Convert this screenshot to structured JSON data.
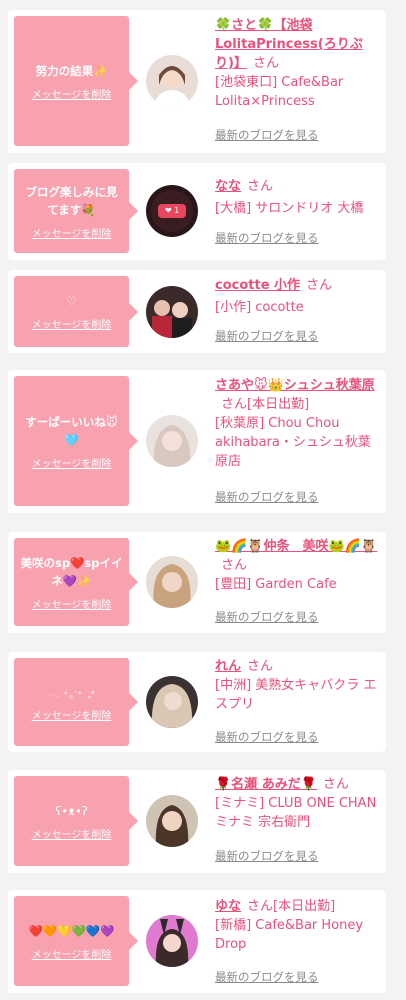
{
  "delete_label": "メッセージを削除",
  "blog_label": "最新のブログを見る",
  "san_label": "さん",
  "colors": {
    "accent": "#e8527b",
    "bubble": "#f8a2b0",
    "background": "#f3f3f3",
    "card": "#ffffff",
    "link_gray": "#8a8a8a"
  },
  "cards": [
    {
      "message": "努力の結果✨",
      "name": "🍀さと🍀【池袋LolitaPrincess(ろりぷり)】",
      "suffix": "",
      "shop": "[池袋東口] Cafe&Bar Lolita×Princess",
      "avatar": "avatar-photo-1"
    },
    {
      "message": "ブログ楽しみに見てます💐",
      "name": "なな",
      "suffix": "",
      "shop": "[大橋] サロンドリオ 大橋",
      "avatar": "avatar-photo-2",
      "avatar_badge": "❤ 1"
    },
    {
      "message": "♡",
      "name": "cocotte 小作",
      "suffix": "",
      "shop": "[小作] cocotte",
      "avatar": "avatar-photo-3"
    },
    {
      "message": "すーぱーいいね🐭🩵",
      "name": "さあや🐭👑シュシュ秋葉原",
      "suffix": "[本日出勤]",
      "shop": "[秋葉原] Chou Chou akihabara・シュシュ秋葉原店",
      "avatar": "avatar-photo-4"
    },
    {
      "message": "美咲のsp❤️spイイネ💜✨",
      "name": "🐸🌈🦉仲条　美咲🐸🌈🦉",
      "suffix": "",
      "shop": "[豊田] Garden Cafe",
      "avatar": "avatar-photo-5"
    },
    {
      "message": "𓂃 ˖˳·˖ ִֶָ ⋆",
      "name": "れん",
      "suffix": "",
      "shop": "[中洲] 美熟女キャバクラ エスプリ",
      "avatar": "avatar-photo-6"
    },
    {
      "message": "ʕ•ᴥ•ʔ",
      "name": "🌹名瀬 あみだ🌹",
      "suffix": "",
      "shop": "[ミナミ] CLUB ONE CHAN ミナミ 宗右衛門",
      "avatar": "avatar-photo-7"
    },
    {
      "message": "❤️🧡💛💚💙💜",
      "name": "ゆな",
      "suffix": "[本日出勤]",
      "shop": "[新橋] Cafe&Bar Honey Drop",
      "avatar": "avatar-photo-8"
    }
  ]
}
